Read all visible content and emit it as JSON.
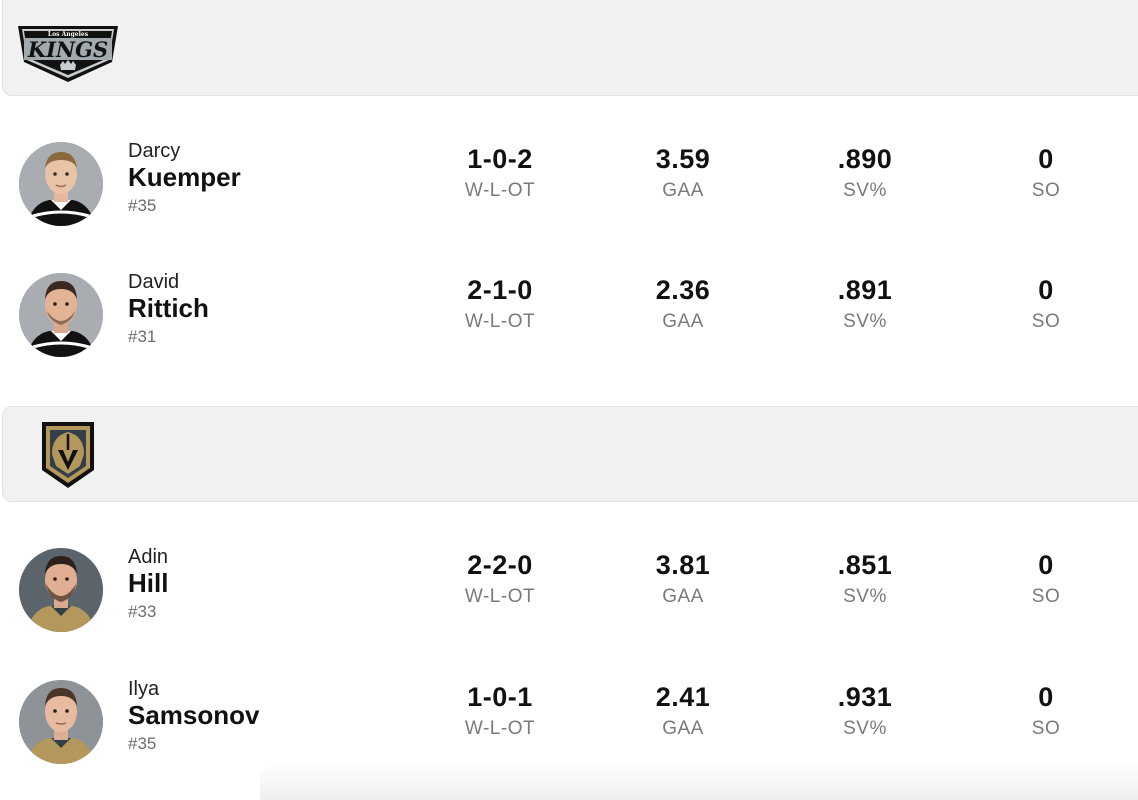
{
  "teams": [
    {
      "name": "Los Angeles Kings",
      "logo_text_top": "Los Angeles",
      "logo_text_main": "KINGS",
      "goalies": [
        {
          "first": "Darcy",
          "last": "Kuemper",
          "number": "#35",
          "jersey": "kings",
          "stats": [
            {
              "value": "1-0-2",
              "label": "W-L-OT"
            },
            {
              "value": "3.59",
              "label": "GAA"
            },
            {
              "value": ".890",
              "label": "SV%"
            },
            {
              "value": "0",
              "label": "SO"
            }
          ]
        },
        {
          "first": "David",
          "last": "Rittich",
          "number": "#31",
          "jersey": "kings",
          "stats": [
            {
              "value": "2-1-0",
              "label": "W-L-OT"
            },
            {
              "value": "2.36",
              "label": "GAA"
            },
            {
              "value": ".891",
              "label": "SV%"
            },
            {
              "value": "0",
              "label": "SO"
            }
          ]
        }
      ]
    },
    {
      "name": "Vegas Golden Knights",
      "goalies": [
        {
          "first": "Adin",
          "last": "Hill",
          "number": "#33",
          "jersey": "vegas",
          "stats": [
            {
              "value": "2-2-0",
              "label": "W-L-OT"
            },
            {
              "value": "3.81",
              "label": "GAA"
            },
            {
              "value": ".851",
              "label": "SV%"
            },
            {
              "value": "0",
              "label": "SO"
            }
          ]
        },
        {
          "first": "Ilya",
          "last": "Samsonov",
          "number": "#35",
          "jersey": "vegas",
          "stats": [
            {
              "value": "1-0-1",
              "label": "W-L-OT"
            },
            {
              "value": "2.41",
              "label": "GAA"
            },
            {
              "value": ".931",
              "label": "SV%"
            },
            {
              "value": "0",
              "label": "SO"
            }
          ]
        }
      ]
    }
  ],
  "colors": {
    "header_bg": "#f1f1f1",
    "kings_black": "#111111",
    "kings_silver": "#a2aaad",
    "vegas_gold": "#b4975a",
    "vegas_steel": "#333f48"
  }
}
